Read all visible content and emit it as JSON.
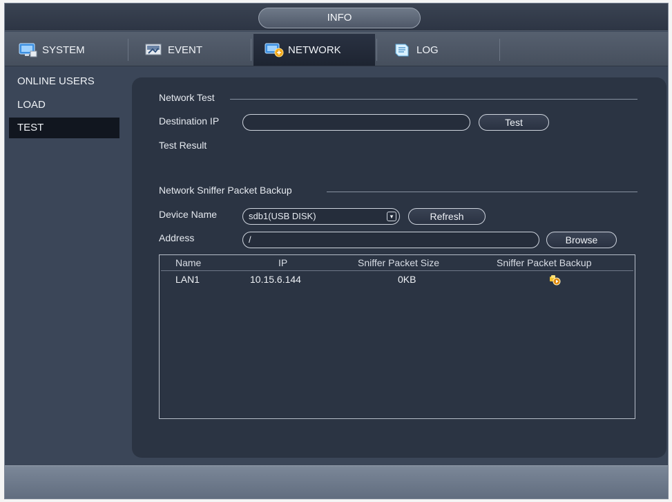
{
  "window": {
    "title": "INFO"
  },
  "tabs": [
    {
      "label": "SYSTEM",
      "icon": "monitor-icon"
    },
    {
      "label": "EVENT",
      "icon": "event-icon"
    },
    {
      "label": "NETWORK",
      "icon": "network-icon",
      "active": true
    },
    {
      "label": "LOG",
      "icon": "log-icon"
    }
  ],
  "menu": [
    {
      "label": "ONLINE USERS"
    },
    {
      "label": "LOAD"
    },
    {
      "label": "TEST",
      "active": true
    }
  ],
  "network_test": {
    "section_title": "Network Test",
    "destination_label": "Destination IP",
    "destination_value": "",
    "test_button": "Test",
    "result_label": "Test Result"
  },
  "sniffer": {
    "section_title": "Network Sniffer Packet Backup",
    "device_label": "Device Name",
    "device_value": "sdb1(USB DISK)",
    "refresh_button": "Refresh",
    "address_label": "Address",
    "address_value": "/",
    "browse_button": "Browse",
    "table": {
      "columns": [
        "Name",
        "IP",
        "Sniffer Packet Size",
        "Sniffer Packet Backup"
      ],
      "rows": [
        {
          "name": "LAN1",
          "ip": "10.15.6.144",
          "size": "0KB",
          "backup_icon": "backup-start-icon"
        }
      ]
    }
  },
  "colors": {
    "background": "#3b4658",
    "panel": "#2b3443",
    "active_tab": "#1d2431",
    "selected_menu": "#11161f"
  }
}
